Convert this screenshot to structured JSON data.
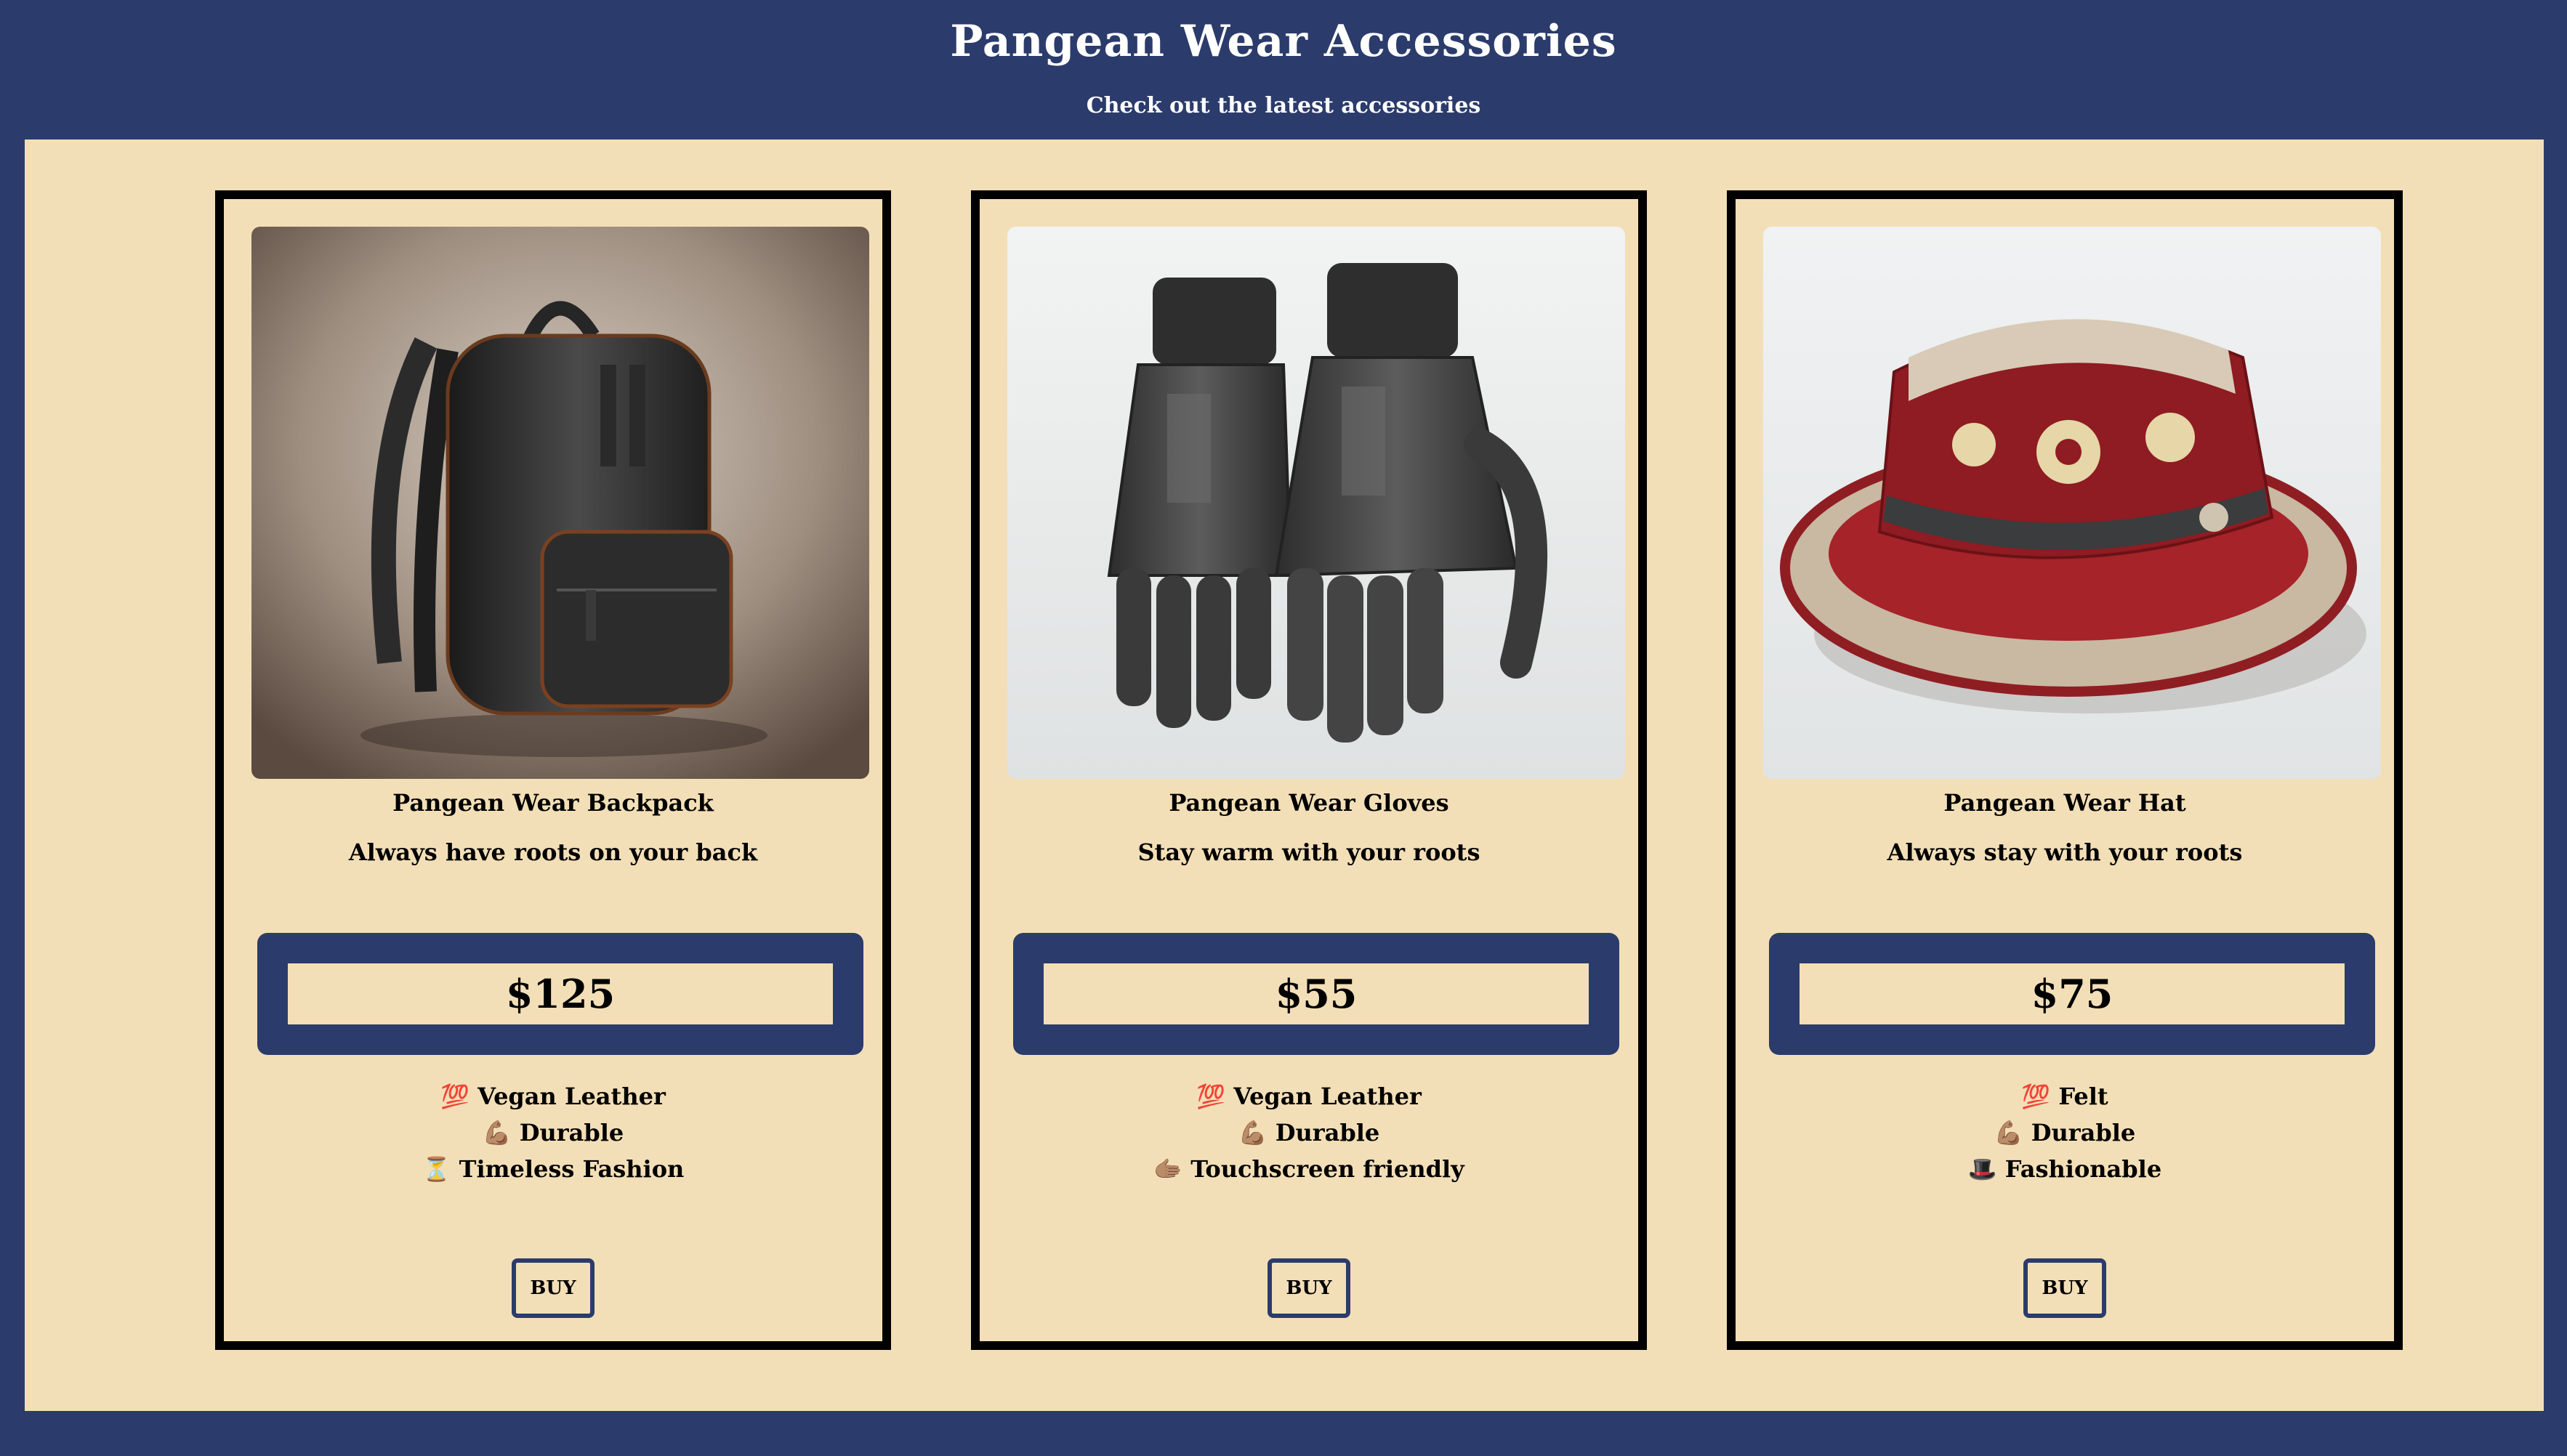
{
  "header": {
    "title": "Pangean Wear Accessories",
    "subtitle": "Check out the latest accessories"
  },
  "colors": {
    "navy": "#2b3b6b",
    "cream": "#f3dfb7",
    "black": "#000000"
  },
  "products": [
    {
      "name": "Pangean Wear Backpack",
      "tagline": "Always have roots on your back",
      "price": "$125",
      "image_icon": "backpack-image",
      "features": [
        {
          "icon": "💯",
          "text": "Vegan Leather"
        },
        {
          "icon": "💪🏽",
          "text": "Durable"
        },
        {
          "icon": "⏳",
          "text": "Timeless Fashion"
        }
      ],
      "button_label": "BUY"
    },
    {
      "name": "Pangean Wear Gloves",
      "tagline": "Stay warm with your roots",
      "price": "$55",
      "image_icon": "gloves-image",
      "features": [
        {
          "icon": "💯",
          "text": "Vegan Leather"
        },
        {
          "icon": "💪🏽",
          "text": "Durable"
        },
        {
          "icon": "🫱🏽",
          "text": "Touchscreen friendly"
        }
      ],
      "button_label": "BUY"
    },
    {
      "name": "Pangean Wear Hat",
      "tagline": "Always stay with your roots",
      "price": "$75",
      "image_icon": "hat-image",
      "features": [
        {
          "icon": "💯",
          "text": "Felt"
        },
        {
          "icon": "💪🏽",
          "text": "Durable"
        },
        {
          "icon": "🎩",
          "text": "Fashionable"
        }
      ],
      "button_label": "BUY"
    }
  ]
}
